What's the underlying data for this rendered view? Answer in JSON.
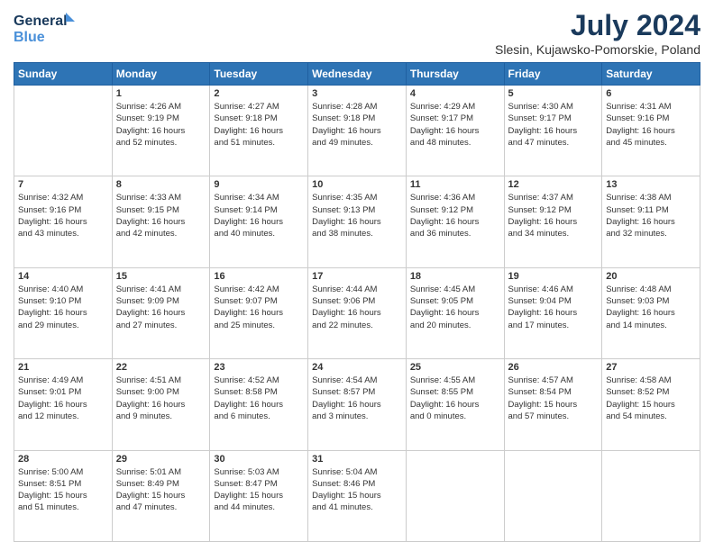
{
  "header": {
    "logo_line1": "General",
    "logo_line2": "Blue",
    "title": "July 2024",
    "subtitle": "Slesin, Kujawsko-Pomorskie, Poland"
  },
  "weekdays": [
    "Sunday",
    "Monday",
    "Tuesday",
    "Wednesday",
    "Thursday",
    "Friday",
    "Saturday"
  ],
  "weeks": [
    [
      {
        "day": "",
        "info": ""
      },
      {
        "day": "1",
        "info": "Sunrise: 4:26 AM\nSunset: 9:19 PM\nDaylight: 16 hours\nand 52 minutes."
      },
      {
        "day": "2",
        "info": "Sunrise: 4:27 AM\nSunset: 9:18 PM\nDaylight: 16 hours\nand 51 minutes."
      },
      {
        "day": "3",
        "info": "Sunrise: 4:28 AM\nSunset: 9:18 PM\nDaylight: 16 hours\nand 49 minutes."
      },
      {
        "day": "4",
        "info": "Sunrise: 4:29 AM\nSunset: 9:17 PM\nDaylight: 16 hours\nand 48 minutes."
      },
      {
        "day": "5",
        "info": "Sunrise: 4:30 AM\nSunset: 9:17 PM\nDaylight: 16 hours\nand 47 minutes."
      },
      {
        "day": "6",
        "info": "Sunrise: 4:31 AM\nSunset: 9:16 PM\nDaylight: 16 hours\nand 45 minutes."
      }
    ],
    [
      {
        "day": "7",
        "info": "Sunrise: 4:32 AM\nSunset: 9:16 PM\nDaylight: 16 hours\nand 43 minutes."
      },
      {
        "day": "8",
        "info": "Sunrise: 4:33 AM\nSunset: 9:15 PM\nDaylight: 16 hours\nand 42 minutes."
      },
      {
        "day": "9",
        "info": "Sunrise: 4:34 AM\nSunset: 9:14 PM\nDaylight: 16 hours\nand 40 minutes."
      },
      {
        "day": "10",
        "info": "Sunrise: 4:35 AM\nSunset: 9:13 PM\nDaylight: 16 hours\nand 38 minutes."
      },
      {
        "day": "11",
        "info": "Sunrise: 4:36 AM\nSunset: 9:12 PM\nDaylight: 16 hours\nand 36 minutes."
      },
      {
        "day": "12",
        "info": "Sunrise: 4:37 AM\nSunset: 9:12 PM\nDaylight: 16 hours\nand 34 minutes."
      },
      {
        "day": "13",
        "info": "Sunrise: 4:38 AM\nSunset: 9:11 PM\nDaylight: 16 hours\nand 32 minutes."
      }
    ],
    [
      {
        "day": "14",
        "info": "Sunrise: 4:40 AM\nSunset: 9:10 PM\nDaylight: 16 hours\nand 29 minutes."
      },
      {
        "day": "15",
        "info": "Sunrise: 4:41 AM\nSunset: 9:09 PM\nDaylight: 16 hours\nand 27 minutes."
      },
      {
        "day": "16",
        "info": "Sunrise: 4:42 AM\nSunset: 9:07 PM\nDaylight: 16 hours\nand 25 minutes."
      },
      {
        "day": "17",
        "info": "Sunrise: 4:44 AM\nSunset: 9:06 PM\nDaylight: 16 hours\nand 22 minutes."
      },
      {
        "day": "18",
        "info": "Sunrise: 4:45 AM\nSunset: 9:05 PM\nDaylight: 16 hours\nand 20 minutes."
      },
      {
        "day": "19",
        "info": "Sunrise: 4:46 AM\nSunset: 9:04 PM\nDaylight: 16 hours\nand 17 minutes."
      },
      {
        "day": "20",
        "info": "Sunrise: 4:48 AM\nSunset: 9:03 PM\nDaylight: 16 hours\nand 14 minutes."
      }
    ],
    [
      {
        "day": "21",
        "info": "Sunrise: 4:49 AM\nSunset: 9:01 PM\nDaylight: 16 hours\nand 12 minutes."
      },
      {
        "day": "22",
        "info": "Sunrise: 4:51 AM\nSunset: 9:00 PM\nDaylight: 16 hours\nand 9 minutes."
      },
      {
        "day": "23",
        "info": "Sunrise: 4:52 AM\nSunset: 8:58 PM\nDaylight: 16 hours\nand 6 minutes."
      },
      {
        "day": "24",
        "info": "Sunrise: 4:54 AM\nSunset: 8:57 PM\nDaylight: 16 hours\nand 3 minutes."
      },
      {
        "day": "25",
        "info": "Sunrise: 4:55 AM\nSunset: 8:55 PM\nDaylight: 16 hours\nand 0 minutes."
      },
      {
        "day": "26",
        "info": "Sunrise: 4:57 AM\nSunset: 8:54 PM\nDaylight: 15 hours\nand 57 minutes."
      },
      {
        "day": "27",
        "info": "Sunrise: 4:58 AM\nSunset: 8:52 PM\nDaylight: 15 hours\nand 54 minutes."
      }
    ],
    [
      {
        "day": "28",
        "info": "Sunrise: 5:00 AM\nSunset: 8:51 PM\nDaylight: 15 hours\nand 51 minutes."
      },
      {
        "day": "29",
        "info": "Sunrise: 5:01 AM\nSunset: 8:49 PM\nDaylight: 15 hours\nand 47 minutes."
      },
      {
        "day": "30",
        "info": "Sunrise: 5:03 AM\nSunset: 8:47 PM\nDaylight: 15 hours\nand 44 minutes."
      },
      {
        "day": "31",
        "info": "Sunrise: 5:04 AM\nSunset: 8:46 PM\nDaylight: 15 hours\nand 41 minutes."
      },
      {
        "day": "",
        "info": ""
      },
      {
        "day": "",
        "info": ""
      },
      {
        "day": "",
        "info": ""
      }
    ]
  ]
}
